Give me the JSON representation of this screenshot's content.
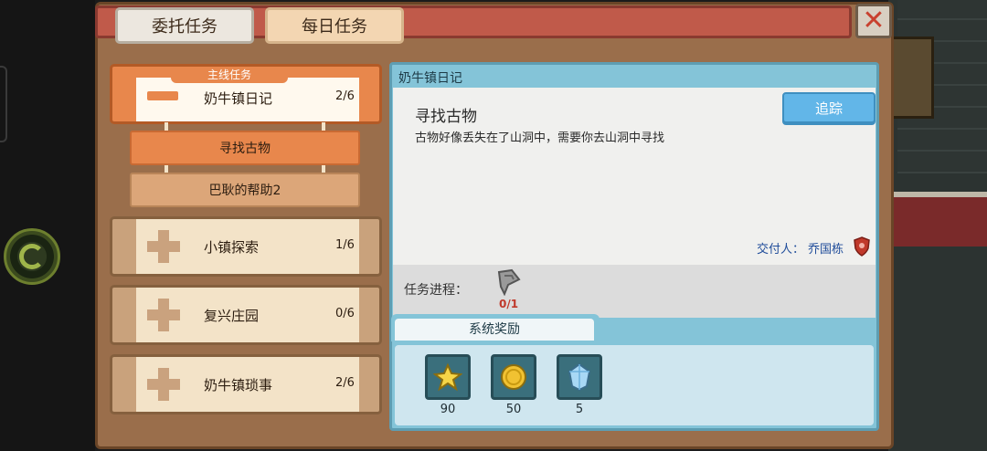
{
  "tabs": {
    "commission": "委托任务",
    "daily": "每日任务"
  },
  "close_symbol": "✕",
  "quest_groups": [
    {
      "label": "主线任务",
      "name": "奶牛镇日记",
      "count": "2/6",
      "active": true
    },
    {
      "name": "小镇探索",
      "count": "1/6"
    },
    {
      "name": "复兴庄园",
      "count": "0/6"
    },
    {
      "name": "奶牛镇琐事",
      "count": "2/6"
    }
  ],
  "sub_tasks": [
    {
      "name": "寻找古物",
      "state": "current"
    },
    {
      "name": "巴耿的帮助2",
      "state": "next"
    }
  ],
  "detail": {
    "header": "奶牛镇日记",
    "task_title": "寻找古物",
    "task_desc": "古物好像丢失在了山洞中，需要你去山洞中寻找",
    "track_button": "追踪",
    "giver_label": "交付人：",
    "giver_name": "乔国栋",
    "progress_label": "任务进程：",
    "progress_value": "0/1",
    "progress_item_icon": "relic-shard-icon",
    "reward_tab": "系统奖励",
    "rewards": [
      {
        "icon": "star-icon",
        "qty": "90"
      },
      {
        "icon": "coin-icon",
        "qty": "50"
      },
      {
        "icon": "crystal-icon",
        "qty": "5"
      }
    ]
  },
  "colors": {
    "panel_brown": "#9a6e4b",
    "active_orange": "#e8874c",
    "title_red": "#c05a4a",
    "detail_blue": "#84c4d8",
    "track_blue": "#62b6e8",
    "progress_red": "#c0392b"
  }
}
